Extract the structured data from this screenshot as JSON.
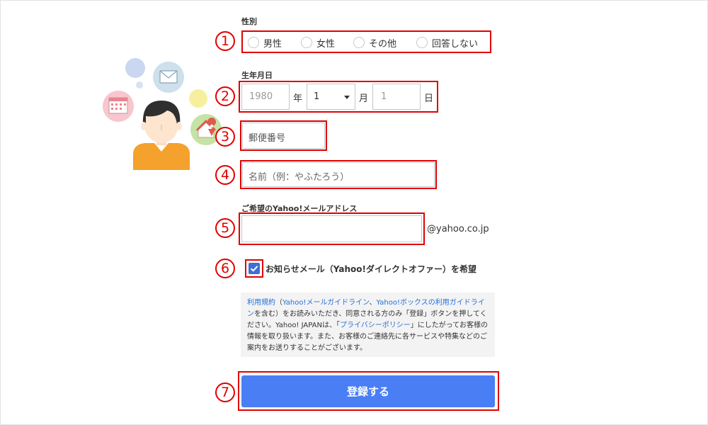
{
  "gender": {
    "label": "性別",
    "options": [
      "男性",
      "女性",
      "その他",
      "回答しない"
    ]
  },
  "birthdate": {
    "label": "生年月日",
    "year_placeholder": "1980",
    "year_unit": "年",
    "month_value": "1",
    "month_unit": "月",
    "day_placeholder": "1",
    "day_unit": "日"
  },
  "postal": {
    "placeholder": "郵便番号"
  },
  "name": {
    "placeholder": "名前（例：やふたろう）"
  },
  "email": {
    "label": "ご希望のYahoo!メールアドレス",
    "value": "",
    "domain": "@yahoo.co.jp"
  },
  "newsletter": {
    "checked": true,
    "label": "お知らせメール（Yahoo!ダイレクトオファー）を希望"
  },
  "terms": {
    "link1": "利用規約",
    "paren_open": "（",
    "link2": "Yahoo!メールガイドライン",
    "sep": "、",
    "link3": "Yahoo!ボックスの利用ガイドライン",
    "text1": "を含む）をお読みいただき、同意される方のみ「登録」ボタンを押してください。Yahoo! JAPANは、「",
    "link4": "プライバシーポリシー",
    "text2": "」にしたがってお客様の情報を取り扱います。また、お客様のご連絡先に各サービスや特集などのご案内をお送りすることがございます。"
  },
  "submit": {
    "label": "登録する"
  },
  "markers": [
    "1",
    "2",
    "3",
    "4",
    "5",
    "6",
    "7"
  ],
  "colors": {
    "highlight": "#e00000",
    "primary_button": "#4a7ef5",
    "link": "#2570d8",
    "checkbox": "#3d6fd4"
  },
  "illustration": {
    "icons": [
      "person-avatar-icon",
      "mail-icon",
      "calendar-icon",
      "home-location-icon"
    ]
  }
}
